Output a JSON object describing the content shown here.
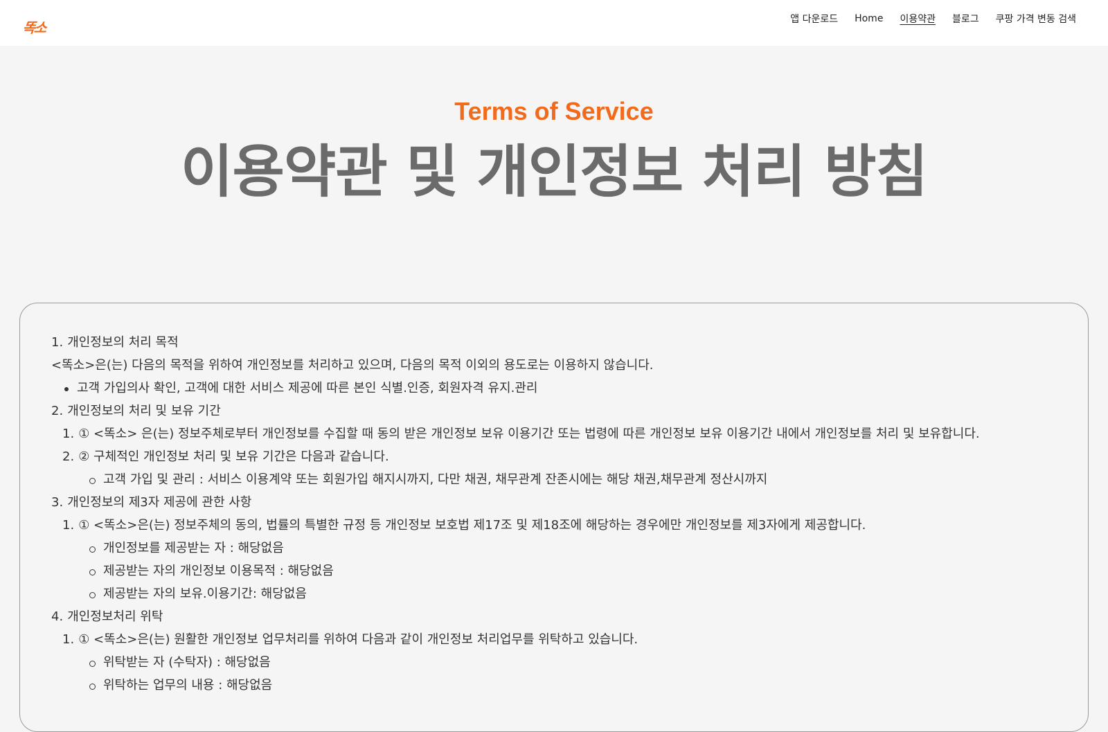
{
  "brand": {
    "logo_text": "똑소",
    "accent_color": "#f26a1b"
  },
  "nav": {
    "items": [
      {
        "label": "앱 다운로드",
        "active": false
      },
      {
        "label": "Home",
        "active": false
      },
      {
        "label": "이용약관",
        "active": true
      },
      {
        "label": "블로그",
        "active": false
      },
      {
        "label": "쿠팡 가격 변동 검색",
        "active": false
      }
    ]
  },
  "hero": {
    "eyebrow": "Terms of Service",
    "title": "이용약관 및 개인정보 처리 방침"
  },
  "policy": {
    "lines": [
      {
        "type": "heading",
        "num": "1.",
        "text": "개인정보의 처리 목적"
      },
      {
        "type": "para",
        "text": "<똑소>은(는) 다음의 목적을 위하여 개인정보를 처리하고 있으며, 다음의 목적 이외의 용도로는 이용하지 않습니다."
      },
      {
        "type": "disc",
        "text": "고객 가입의사 확인, 고객에 대한 서비스 제공에 따른 본인 식별.인증, 회원자격 유지.관리"
      },
      {
        "type": "heading",
        "num": "2.",
        "text": "개인정보의 처리 및 보유 기간"
      },
      {
        "type": "sub",
        "num": "1.",
        "text": "① <똑소> 은(는) 정보주체로부터 개인정보를 수집할 때 동의 받은 개인정보 보유 이용기간 또는 법령에 따른 개인정보 보유 이용기간 내에서 개인정보를 처리 및 보유합니다."
      },
      {
        "type": "sub",
        "num": "2.",
        "text": "② 구체적인 개인정보 처리 및 보유 기간은 다음과 같습니다."
      },
      {
        "type": "circle",
        "text": "고객 가입 및 관리 : 서비스 이용계약 또는 회원가입 해지시까지, 다만 채권, 채무관계 잔존시에는 해당 채권,채무관계 정산시까지"
      },
      {
        "type": "heading",
        "num": "3.",
        "text": "개인정보의 제3자 제공에 관한 사항"
      },
      {
        "type": "sub",
        "num": "1.",
        "text": "① <똑소>은(는) 정보주체의 동의, 법률의 특별한 규정 등 개인정보 보호법 제17조 및 제18조에 해당하는 경우에만 개인정보를 제3자에게 제공합니다."
      },
      {
        "type": "circle",
        "text": "개인정보를 제공받는 자 : 해당없음"
      },
      {
        "type": "circle",
        "text": "제공받는 자의 개인정보 이용목적 : 해당없음"
      },
      {
        "type": "circle",
        "text": "제공받는 자의 보유.이용기간: 해당없음"
      },
      {
        "type": "heading",
        "num": "4.",
        "text": "개인정보처리 위탁"
      },
      {
        "type": "sub",
        "num": "1.",
        "text": "① <똑소>은(는) 원활한 개인정보 업무처리를 위하여 다음과 같이 개인정보 처리업무를 위탁하고 있습니다."
      },
      {
        "type": "circle",
        "text": "위탁받는 자 (수탁자) : 해당없음"
      },
      {
        "type": "circle",
        "text": "위탁하는 업무의 내용 : 해당없음"
      }
    ]
  }
}
